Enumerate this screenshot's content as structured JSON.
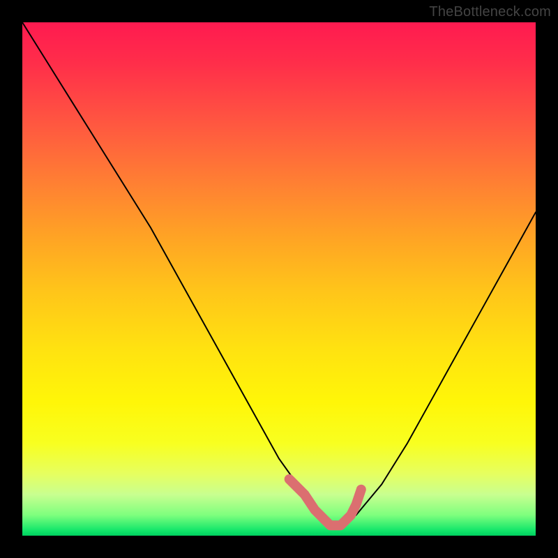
{
  "watermark": "TheBottleneck.com",
  "chart_data": {
    "type": "line",
    "title": "",
    "xlabel": "",
    "ylabel": "",
    "xlim": [
      0,
      100
    ],
    "ylim": [
      0,
      100
    ],
    "x": [
      0,
      5,
      10,
      15,
      20,
      25,
      30,
      35,
      40,
      45,
      50,
      55,
      58,
      60,
      62,
      65,
      70,
      75,
      80,
      85,
      90,
      95,
      100
    ],
    "series": [
      {
        "name": "bottleneck-curve",
        "color": "#000000",
        "values": [
          100,
          92,
          84,
          76,
          68,
          60,
          51,
          42,
          33,
          24,
          15,
          8,
          4,
          2,
          2,
          4,
          10,
          18,
          27,
          36,
          45,
          54,
          63
        ]
      }
    ],
    "highlight": {
      "name": "optimal-range-marker",
      "color": "#db6f70",
      "x": [
        52,
        55,
        57,
        58,
        59,
        60,
        61,
        62,
        63,
        64,
        65,
        66
      ],
      "values": [
        11,
        8,
        5,
        4,
        3,
        2,
        2,
        2,
        3,
        4,
        6,
        9
      ]
    },
    "background_gradient": {
      "top": "#ff1a50",
      "mid": "#ffe310",
      "bottom": "#00d060"
    }
  }
}
